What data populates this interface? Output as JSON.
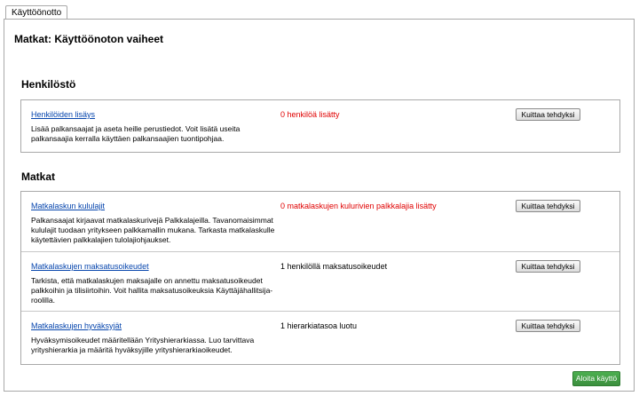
{
  "tab": {
    "label": "Käyttöönotto"
  },
  "page": {
    "title": "Matkat: Käyttöönoton vaiheet"
  },
  "sections": [
    {
      "title": "Henkilöstö",
      "rows": [
        {
          "link": "Henkilöiden lisäys",
          "description": "Lisää palkansaajat ja aseta heille perustiedot. Voit lisätä useita palkansaajia kerralla käyttäen palkansaajien tuontipohjaa.",
          "status": "0 henkilöä lisätty",
          "button": "Kuittaa tehdyksi"
        }
      ]
    },
    {
      "title": "Matkat",
      "rows": [
        {
          "link": "Matkalaskun kululajit",
          "description": "Palkansaajat kirjaavat matkalaskurivejä Palkkalajeilla. Tavanomaisimmat kululajit tuodaan yritykseen palkkamallin mukana. Tarkasta matkalaskulle käytettävien palkkalajien tulolajiohjaukset.",
          "status": "0 matkalaskujen kulurivien palkkalajia lisätty",
          "button": "Kuittaa tehdyksi"
        },
        {
          "link": "Matkalaskujen maksatusoikeudet",
          "description": "Tarkista, että matkalaskujen maksajalle on annettu maksatusoikeudet palkkoihin ja tilisiirtoihin. Voit hallita maksatusoikeuksia Käyttäjähallitsija-roolilla.",
          "status": "1 henkilöllä maksatusoikeudet",
          "button": "Kuittaa tehdyksi"
        },
        {
          "link": "Matkalaskujen hyväksyjät",
          "description": "Hyväksymisoikeudet määritellään Yrityshierarkiassa. Luo tarvittava yrityshierarkia ja määritä hyväksyjille yrityshierarkiaoikeudet.",
          "status": "1 hierarkiatasoa luotu",
          "button": "Kuittaa tehdyksi"
        }
      ]
    }
  ],
  "footer": {
    "start_button": "Aloita käyttö"
  },
  "colors": {
    "link": "#0645ad",
    "warning": "#e00000",
    "primary_button": "#3b8f3e"
  }
}
